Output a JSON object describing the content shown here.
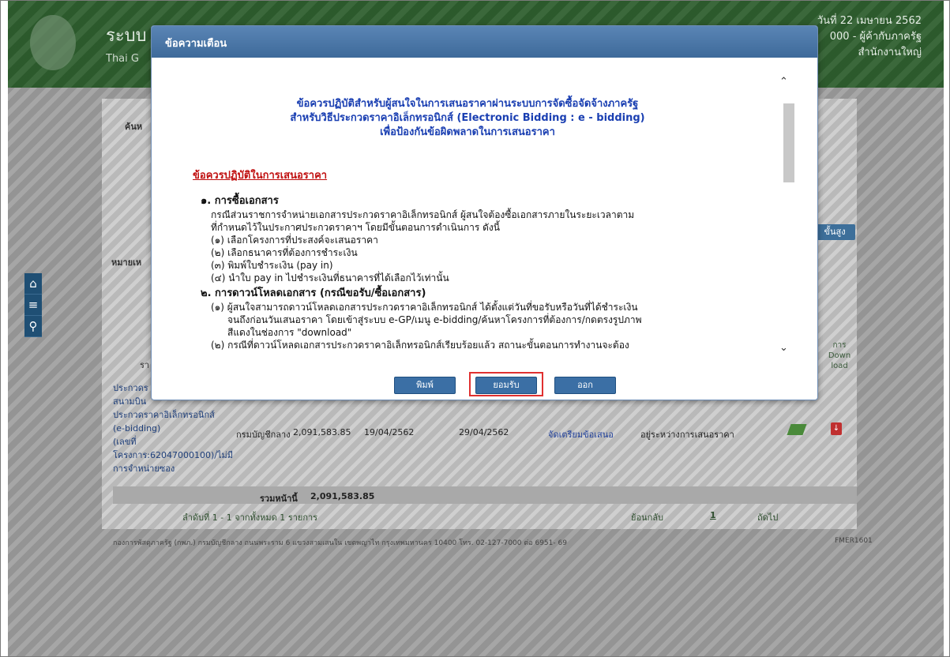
{
  "header": {
    "title": "ระบบ",
    "subtitle": "Thai G",
    "date": "วันที่ 22 เมษายน 2562",
    "user": "000 - ผู้ค้ากับภาครัฐ",
    "office": "สำนักงานใหญ่"
  },
  "side_nav": {
    "icons": [
      "home-icon",
      "menu-icon",
      "search-icon"
    ]
  },
  "content": {
    "search_label": "ค้นห",
    "remark_label": "หมายเห",
    "advanced_button": "ขั้นสูง",
    "col_ra": "รา",
    "download_header": [
      "การ",
      "Down",
      "load"
    ],
    "row": {
      "project_lines": [
        "ประกวดร",
        "สนามบิน",
        "ประกวดราคาอิเล็กทรอนิกส์",
        "(e-bidding)",
        "(เลขที่",
        "โครงการ:62047000100)/ไม่มี",
        "การจำหน่ายซอง"
      ],
      "department": "กรมบัญชีกลาง",
      "amount": "2,091,583.85",
      "date_start": "19/04/2562",
      "date_end": "29/04/2562",
      "action_link": "จัดเตรียมข้อเสนอ",
      "status": "อยู่ระหว่างการเสนอราคา"
    },
    "sum_label": "รวมหน้านี้",
    "sum_value": "2,091,583.85",
    "pager_summary": "ลำดับที่ 1 - 1 จากทั้งหมด 1 รายการ",
    "pager_prev": "ย้อนกลับ",
    "pager_page": "1",
    "pager_next": "ถัดไป",
    "footer_text": "กองการพัสดุภาครัฐ (กพภ.) กรมบัญชีกลาง ถนนพระราม 6 แขวงสามเสนใน เขตพญาไท กรุงเทพมหานคร 10400 โทร. 02-127-7000 ต่อ 6951- 69",
    "footer_code": "FMER1601"
  },
  "modal": {
    "title": "ข้อความเตือน",
    "heading_lines": [
      "ข้อควรปฏิบัติสำหรับผู้สนใจในการเสนอราคาผ่านระบบการจัดซื้อจัดจ้างภาครัฐ",
      "สำหรับวิธีประกวดราคาอิเล็กทรอนิกส์ (Electronic Bidding : e - bidding)",
      "เพื่อป้องกันข้อผิดพลาดในการเสนอราคา"
    ],
    "section_title": "ข้อควรปฏิบัติในการเสนอราคา",
    "item1_title": "๑. การซื้อเอกสาร",
    "item1_lines": [
      "กรณีส่วนราชการจำหน่ายเอกสารประกวดราคาอิเล็กทรอนิกส์ ผู้สนใจต้องซื้อเอกสารภายในระยะเวลาตาม",
      "ที่กำหนดไว้ในประกาศประกวดราคาฯ โดยมีขั้นตอนการดำเนินการ ดังนี้",
      "(๑) เลือกโครงการที่ประสงค์จะเสนอราคา",
      "(๒) เลือกธนาคารที่ต้องการชำระเงิน",
      "(๓) พิมพ์ใบชำระเงิน (pay in)",
      "(๔) นำใบ pay in ไปชำระเงินที่ธนาคารที่ได้เลือกไว้เท่านั้น"
    ],
    "item2_title": "๒. การดาวน์โหลดเอกสาร (กรณีขอรับ/ซื้อเอกสาร)",
    "item2_lines": [
      "(๑) ผู้สนใจสามารถดาวน์โหลดเอกสารประกวดราคาอิเล็กทรอนิกส์ ได้ตั้งแต่วันที่ขอรับหรือวันที่ได้ชำระเงิน",
      "จนถึงก่อนวันเสนอราคา โดยเข้าสู่ระบบ e-GP/เมนู e-bidding/ค้นหาโครงการที่ต้องการ/กดตรงรูปภาพ",
      "สีแดงในช่องการ \"download\"",
      "(๒) กรณีที่ดาวน์โหลดเอกสารประกวดราคาอิเล็กทรอนิกส์เรียบร้อยแล้ว สถานะขั้นตอนการทำงานจะต้อง"
    ],
    "buttons": {
      "print": "พิมพ์",
      "accept": "ยอมรับ",
      "exit": "ออก"
    }
  }
}
